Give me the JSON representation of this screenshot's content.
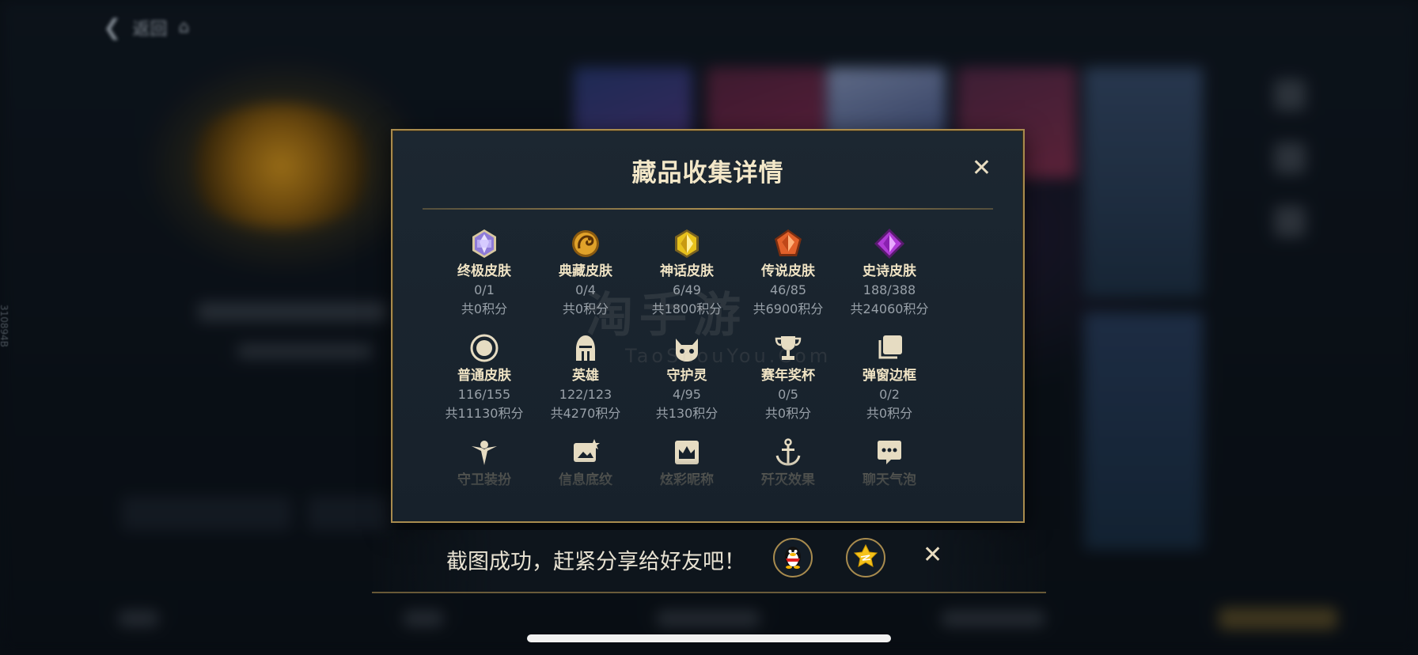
{
  "background": {
    "back_label": "返回",
    "side_text": "310894B"
  },
  "modal": {
    "title": "藏品收集详情",
    "close_label": "✕",
    "items": [
      {
        "name": "终极皮肤",
        "count": "0/1",
        "points": "共0积分",
        "icon": "ultimate-skin-gem-icon"
      },
      {
        "name": "典藏皮肤",
        "count": "0/4",
        "points": "共0积分",
        "icon": "collection-skin-dragon-icon"
      },
      {
        "name": "神话皮肤",
        "count": "6/49",
        "points": "共1800积分",
        "icon": "mythic-skin-gem-icon"
      },
      {
        "name": "传说皮肤",
        "count": "46/85",
        "points": "共6900积分",
        "icon": "legend-skin-gem-icon"
      },
      {
        "name": "史诗皮肤",
        "count": "188/388",
        "points": "共24060积分",
        "icon": "epic-skin-gem-icon"
      },
      {
        "name": "普通皮肤",
        "count": "116/155",
        "points": "共11130积分",
        "icon": "normal-skin-ring-icon"
      },
      {
        "name": "英雄",
        "count": "122/123",
        "points": "共4270积分",
        "icon": "hero-helmet-icon"
      },
      {
        "name": "守护灵",
        "count": "4/95",
        "points": "共130积分",
        "icon": "guardian-spirit-icon"
      },
      {
        "name": "赛年奖杯",
        "count": "0/5",
        "points": "共0积分",
        "icon": "season-trophy-icon"
      },
      {
        "name": "弹窗边框",
        "count": "0/2",
        "points": "共0积分",
        "icon": "popup-frame-icon"
      },
      {
        "name": "守卫装扮",
        "icon": "guard-outfit-icon"
      },
      {
        "name": "信息底纹",
        "icon": "info-texture-icon"
      },
      {
        "name": "炫彩昵称",
        "icon": "colorful-nickname-icon"
      },
      {
        "name": "歼灭效果",
        "icon": "annihilation-effect-icon"
      },
      {
        "name": "聊天气泡",
        "icon": "chat-bubble-icon"
      }
    ]
  },
  "watermark": {
    "text": "淘手游",
    "url": "TaoShouYou.Com"
  },
  "share_bar": {
    "message": "截图成功，赶紧分享给好友吧！",
    "close_label": "✕",
    "buttons": [
      {
        "name": "qq-share-button",
        "icon": "qq-penguin-icon"
      },
      {
        "name": "qzone-share-button",
        "icon": "qzone-star-icon"
      }
    ]
  },
  "colors": {
    "accent_gold": "#a88b4e",
    "modal_bg": "#1c2731",
    "ultimate": "#b9a6ff",
    "collection": "#e0a22a",
    "mythic": "#e8c21c",
    "legend": "#e2612a",
    "epic": "#b03ad6"
  }
}
